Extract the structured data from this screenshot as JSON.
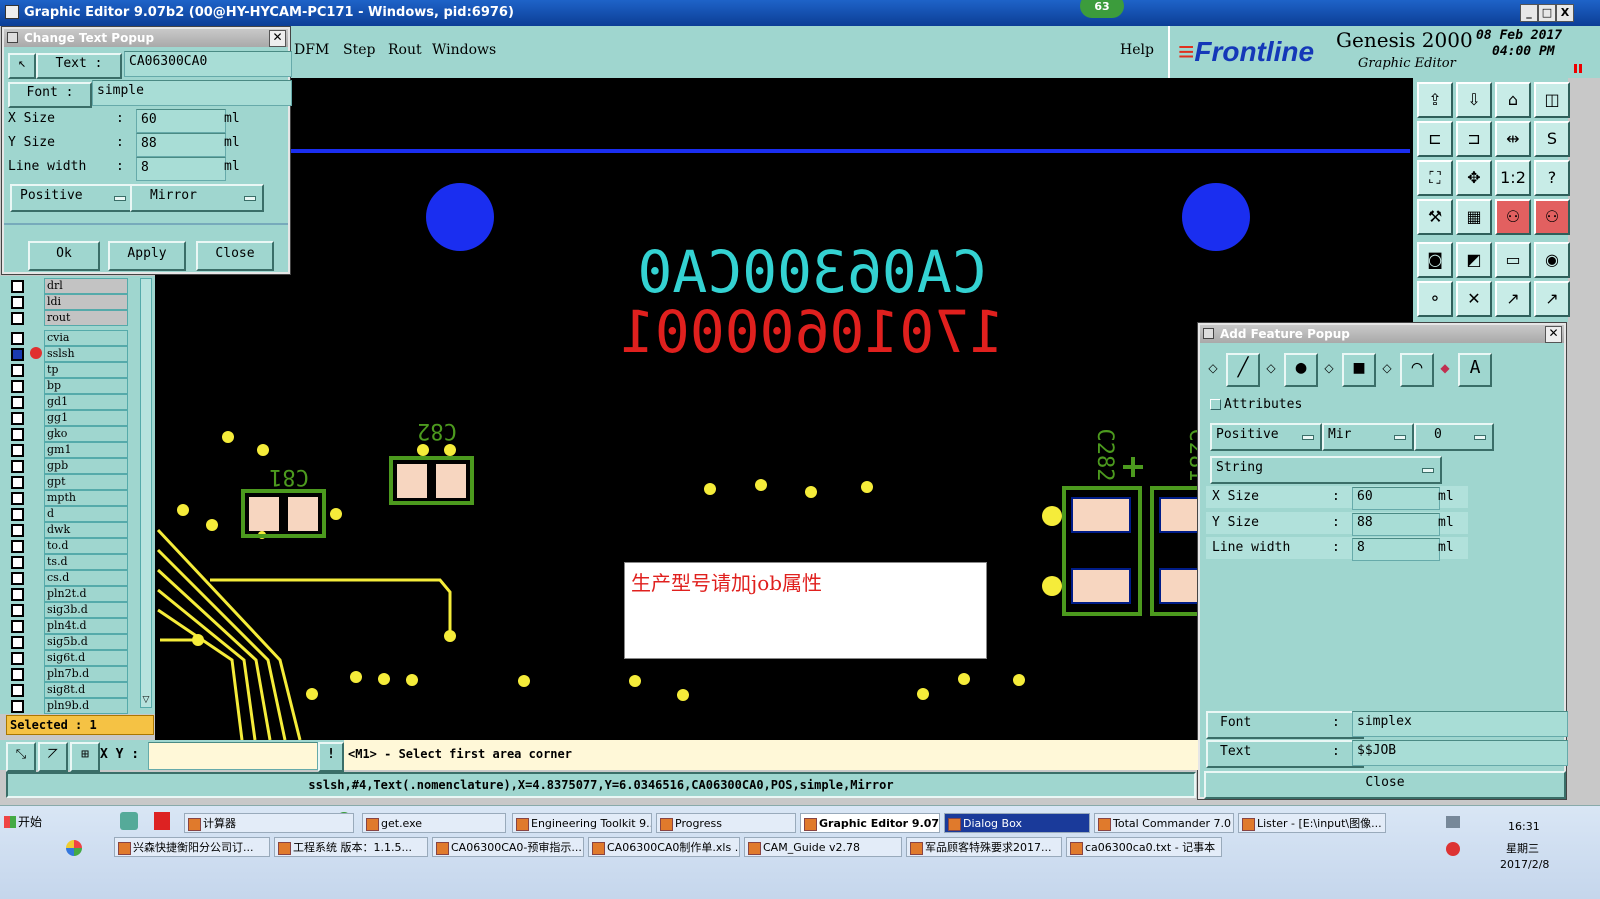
{
  "window": {
    "title": "Graphic Editor 9.07b2 (00@HY-HYCAM-PC171 - Windows, pid:6976)",
    "badge": "63",
    "min": "_",
    "max": "□",
    "close": "X"
  },
  "menu": {
    "items": [
      "DFM",
      "Step",
      "Rout",
      "Windows"
    ],
    "help": "Help"
  },
  "brand": {
    "logo": "Frontline",
    "product": "Genesis 2000",
    "subtitle": "Graphic Editor",
    "date": "08 Feb 2017",
    "time": "04:00 PM"
  },
  "change_text_popup": {
    "title": "Change Text Popup",
    "text_label": "Text :",
    "text_value": "CA06300CA0",
    "font_label": "Font :",
    "font_value": "simple",
    "xsize_label": "X Size",
    "xsize_value": "60",
    "ysize_label": "Y Size",
    "ysize_value": "88",
    "linewidth_label": "Line width",
    "linewidth_value": "8",
    "colon": ":",
    "unit": "ml",
    "polarity": "Positive",
    "mirror": "Mirror",
    "ok": "Ok",
    "apply": "Apply",
    "close": "Close"
  },
  "layers": [
    {
      "name": "drl",
      "grey": true
    },
    {
      "name": "ldi",
      "grey": true
    },
    {
      "name": "rout",
      "grey": true
    },
    {
      "name": "cvia"
    },
    {
      "name": "sslsh",
      "selected": true
    },
    {
      "name": "tp"
    },
    {
      "name": "bp"
    },
    {
      "name": "gd1"
    },
    {
      "name": "gg1"
    },
    {
      "name": "gko"
    },
    {
      "name": "gm1"
    },
    {
      "name": "gpb"
    },
    {
      "name": "gpt"
    },
    {
      "name": "mpth"
    },
    {
      "name": "d"
    },
    {
      "name": "dwk"
    },
    {
      "name": "to.d"
    },
    {
      "name": "ts.d"
    },
    {
      "name": "cs.d"
    },
    {
      "name": "pln2t.d"
    },
    {
      "name": "sig3b.d"
    },
    {
      "name": "pln4t.d"
    },
    {
      "name": "sig5b.d"
    },
    {
      "name": "sig6t.d"
    },
    {
      "name": "pln7b.d"
    },
    {
      "name": "sig8t.d"
    },
    {
      "name": "pln9b.d"
    }
  ],
  "selected_count": "Selected : 1",
  "xy_label": "X Y :",
  "prompt": "<M1> - Select first area corner",
  "status": "sslsh,#4,Text(.nomenclature),X=4.8375077,Y=6.0346516,CA06300CA0,POS,simple,Mirror",
  "canvas": {
    "text1": "CA06300CA0",
    "text2": "17010600001",
    "labels": [
      "C81",
      "C82",
      "C282",
      "C281"
    ],
    "dialog_text": "生产型号请加job属性",
    "colors": {
      "cyan": "#34d2d2",
      "red": "#e0201e",
      "blue": "#1a2ef0",
      "yellow": "#f5ec3a",
      "green": "#4c9a1e",
      "pad": "#f7d6c0"
    }
  },
  "add_feature_popup": {
    "title": "Add Feature Popup",
    "attributes": "Attributes",
    "polarity": "Positive",
    "mir": "Mir",
    "angle": "0",
    "type": "String",
    "xsize_label": "X Size",
    "xsize_value": "60",
    "ysize_label": "Y Size",
    "ysize_value": "88",
    "linewidth_label": "Line width",
    "linewidth_value": "8",
    "colon": ":",
    "unit": "ml",
    "font_label": "Font",
    "font_value": "simplex",
    "text_label": "Text",
    "text_value": "$$JOB",
    "close": "Close"
  },
  "taskbar": {
    "start": "开始",
    "row1": [
      "计算器",
      "get.exe",
      "Engineering Toolkit 9....",
      "Progress",
      "Graphic Editor 9.07...",
      "Dialog Box",
      "Total Commander 7.0 ...",
      "Lister - [E:\\input\\图像..."
    ],
    "row2": [
      "兴森快捷衡阳分公司订...",
      "工程系统  版本：1.1.5...",
      "CA06300CA0-预审指示....",
      "CA06300CA0制作单.xls ...",
      "CAM_Guide v2.78",
      "军品顾客特殊要求2017...",
      "ca06300ca0.txt - 记事本"
    ],
    "clock": "16:31",
    "weekday": "星期三",
    "date": "2017/2/8"
  }
}
